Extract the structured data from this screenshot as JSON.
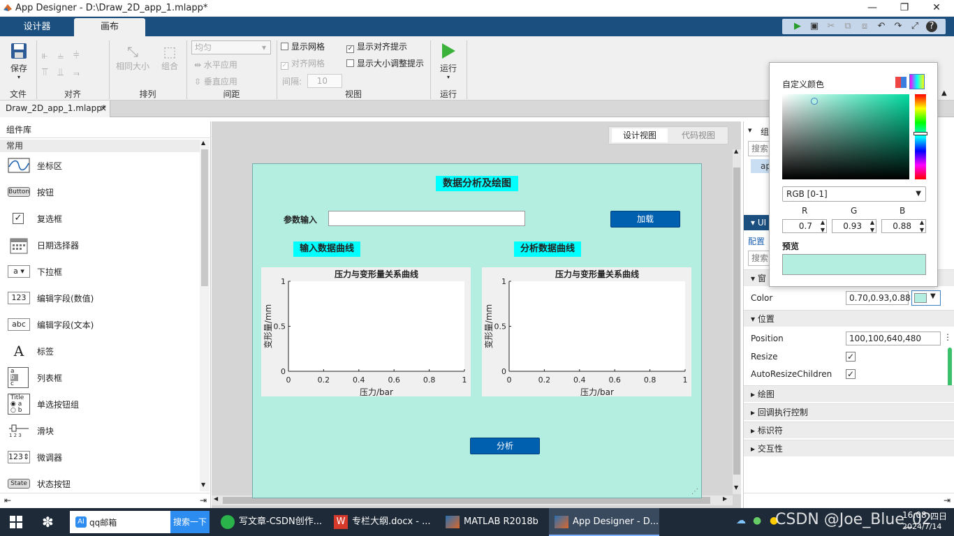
{
  "window": {
    "title": "App Designer - D:\\Draw_2D_app_1.mlapp*",
    "minimize": "—",
    "restore": "❐",
    "close": "✕"
  },
  "ribbon_tabs": [
    "设计器",
    "画布"
  ],
  "ribbon": {
    "save_label": "保存",
    "same_size": "相同大小",
    "group_label": "组合",
    "align_dropdown": "均匀",
    "h_apply": "水平应用",
    "v_apply": "垂直应用",
    "spacing_label": "间隔:",
    "spacing_value": "10",
    "show_grid": "显示网格",
    "snap_grid": "对齐网格",
    "interval_label": "间隔:",
    "show_align_hint": "显示对齐提示",
    "show_resize_hint": "显示大小调整提示",
    "run_label": "运行",
    "groups": [
      "文件",
      "对齐",
      "排列",
      "间距",
      "视图",
      "运行"
    ]
  },
  "doc_tab": {
    "name": "Draw_2D_app_1.mlapp*",
    "close": "×"
  },
  "component_library": {
    "title": "组件库",
    "section": "常用",
    "items": [
      {
        "icon": "axes-icon",
        "label": "坐标区"
      },
      {
        "icon": "Button",
        "label": "按钮"
      },
      {
        "icon": "✓",
        "label": "复选框"
      },
      {
        "icon": "date-icon",
        "label": "日期选择器"
      },
      {
        "icon": "a ▾",
        "label": "下拉框"
      },
      {
        "icon": "123",
        "label": "编辑字段(数值)"
      },
      {
        "icon": "abc",
        "label": "编辑字段(文本)"
      },
      {
        "icon": "A",
        "label": "标签"
      },
      {
        "icon": "listbox-icon",
        "label": "列表框"
      },
      {
        "icon": "radio-icon",
        "label": "单选按钮组"
      },
      {
        "icon": "slider-icon",
        "label": "滑块"
      },
      {
        "icon": "123⇕",
        "label": "微调器"
      },
      {
        "icon": "State",
        "label": "状态按钮"
      }
    ]
  },
  "view_toggle": {
    "design": "设计视图",
    "code": "代码视图"
  },
  "app": {
    "title": "数据分析及绘图",
    "param_label": "参数输入",
    "param_value": "",
    "load_button": "加载",
    "input_curve_label": "输入数据曲线",
    "analysis_curve_label": "分析数据曲线",
    "analyze_button": "分析",
    "bg_color": "#b3eee0",
    "plots": [
      {
        "title": "压力与变形量关系曲线",
        "xlabel": "压力/bar",
        "ylabel": "变形量/mm"
      },
      {
        "title": "压力与变形量关系曲线",
        "xlabel": "压力/bar",
        "ylabel": "变形量/mm"
      }
    ]
  },
  "chart_data": [
    {
      "type": "line",
      "title": "压力与变形量关系曲线",
      "xlabel": "压力/bar",
      "ylabel": "变形量/mm",
      "xlim": [
        0,
        1
      ],
      "ylim": [
        0,
        1
      ],
      "xticks": [
        "0",
        "0.2",
        "0.4",
        "0.6",
        "0.8",
        "1"
      ],
      "yticks": [
        "0",
        "0.5",
        "1"
      ],
      "series": []
    },
    {
      "type": "line",
      "title": "压力与变形量关系曲线",
      "xlabel": "压力/bar",
      "ylabel": "变形量/mm",
      "xlim": [
        0,
        1
      ],
      "ylim": [
        0,
        1
      ],
      "xticks": [
        "0",
        "0.2",
        "0.4",
        "0.6",
        "0.8",
        "1"
      ],
      "yticks": [
        "0",
        "0.5",
        "1"
      ],
      "series": []
    }
  ],
  "right_panel": {
    "browser_label": "组",
    "search_placeholder": "搜索",
    "tree_item": "ap",
    "section_ui": "UI",
    "tab_config": "配置",
    "search2": "搜索",
    "section_window": "窗",
    "color_label": "Color",
    "color_value": "0.70,0.93,0.88",
    "section_position": "位置",
    "position_label": "Position",
    "position_value": "100,100,640,480",
    "resize_label": "Resize",
    "autoresize_label": "AutoResizeChildren",
    "section_draw": "绘图",
    "section_callback": "回调执行控制",
    "section_identifier": "标识符",
    "section_interact": "交互性"
  },
  "color_picker": {
    "title": "自定义颜色",
    "mode": "RGB [0-1]",
    "r_label": "R",
    "g_label": "G",
    "b_label": "B",
    "r": "0.7",
    "g": "0.93",
    "b": "0.88",
    "preview_label": "预览",
    "preview_color": "#b3eee0"
  },
  "taskbar": {
    "search_text": "qq邮箱",
    "search_button": "搜索一下",
    "apps": [
      "写文章-CSDN创作...",
      "专栏大纲.docx - ...",
      "MATLAB R2018b",
      "App Designer - D..."
    ],
    "time": "16:08",
    "weekday": "四日",
    "date": "2024/7/14",
    "watermark": "CSDN @Joe_Blue_02"
  }
}
